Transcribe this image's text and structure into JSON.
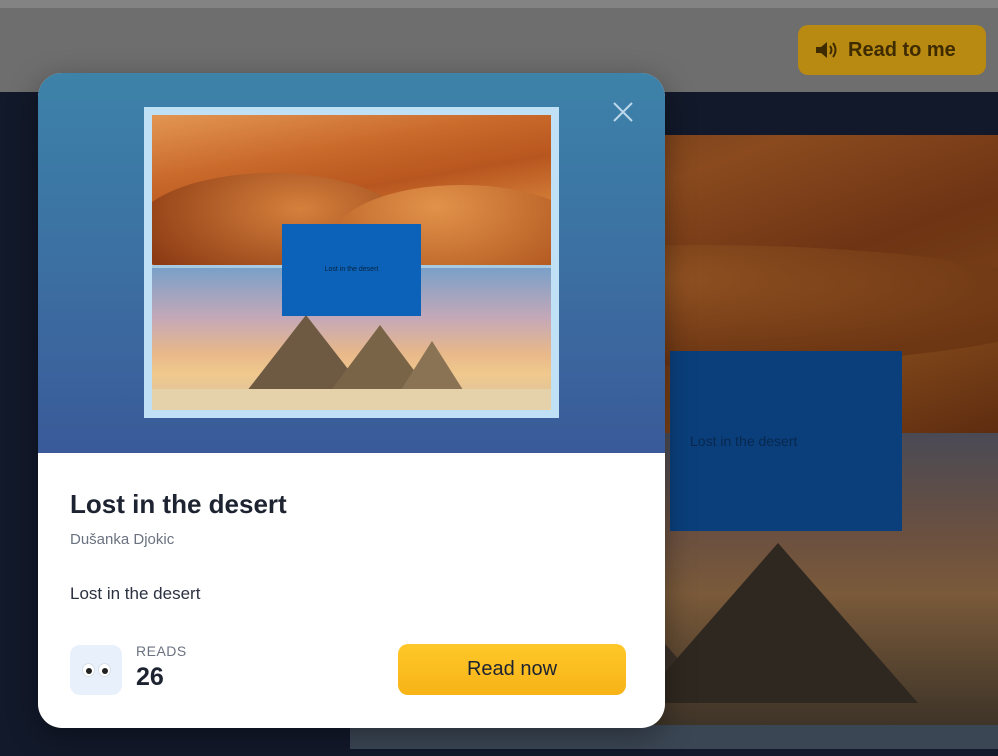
{
  "header": {
    "read_to_me_label": "Read to me"
  },
  "background_book": {
    "cover_text": "Lost in the desert"
  },
  "modal": {
    "cover_text": "Lost in the desert",
    "title": "Lost in the desert",
    "author": "Dušanka Djokic",
    "description": "Lost in the desert",
    "reads_label": "READS",
    "reads_count": "26",
    "read_now_label": "Read now"
  },
  "icons": {
    "close": "close-icon",
    "speaker": "speaker-icon",
    "eyes": "eyes-icon"
  },
  "colors": {
    "accent": "#f7b316",
    "hero_top": "#3d82a9",
    "hero_bottom": "#3a5a99",
    "cover_textbox": "#0b62b8"
  }
}
